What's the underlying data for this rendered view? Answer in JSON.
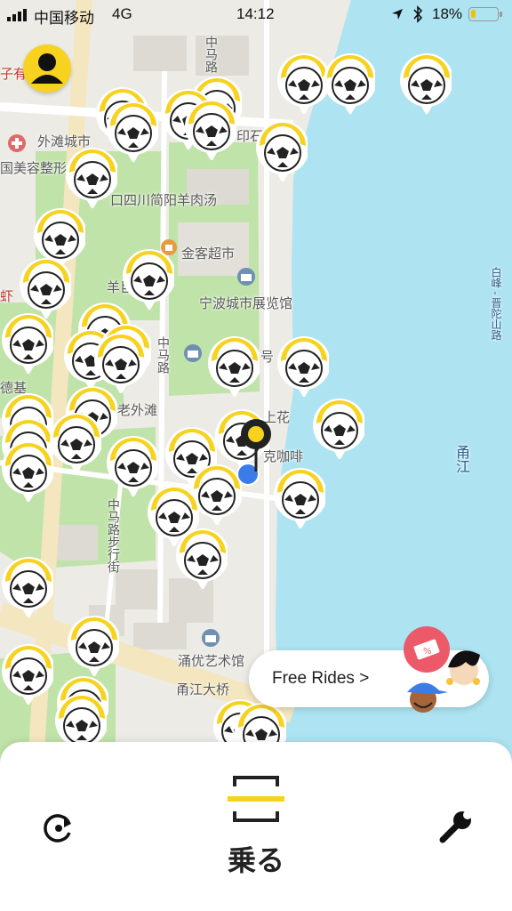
{
  "status_bar": {
    "carrier": "中国移动",
    "network": "4G",
    "time": "14:12",
    "battery_percent": "18%",
    "battery_level": 0.18
  },
  "map": {
    "labels": {
      "waitan_city": "外滩城市",
      "zi_you": "子有",
      "beauty_clinic": "国美容整形",
      "yin": "印石",
      "sichuan_noodle": "口四川简阳羊肉汤",
      "jinke_market": "金客超市",
      "ningbo_museum": "宁波城市展览馆",
      "zhongma_road_top": "中马路",
      "yang_road": "羊巨",
      "zhongma_road_mid": "中马路",
      "hao": "号",
      "shang_hua": "上花",
      "ke_coffee": "克咖啡",
      "lao_waitan": "老外滩",
      "de_ji": "德基",
      "xia": "虾",
      "yongyou_art": "涌优艺术馆",
      "yongjiang_bridge": "甬江大桥",
      "yongjiang": "甬江",
      "baifeng_road": "白峰 - 晋陀山路",
      "zhongma_walk": "中马路步行街"
    }
  },
  "free_rides": {
    "label": "Free Rides >"
  },
  "bottom": {
    "ride_label": "乗る"
  },
  "icons": {
    "bike": "soccer-ball-pin",
    "profile": "person-icon",
    "refresh": "refresh-icon",
    "scan": "scan-icon",
    "settings": "wrench-icon",
    "location": "location-arrow-icon",
    "bluetooth": "bluetooth-icon"
  },
  "colors": {
    "brand_yellow": "#f7d21e",
    "water": "#aee3f2",
    "park": "#bfe3a8",
    "road": "#f4e6bf"
  }
}
